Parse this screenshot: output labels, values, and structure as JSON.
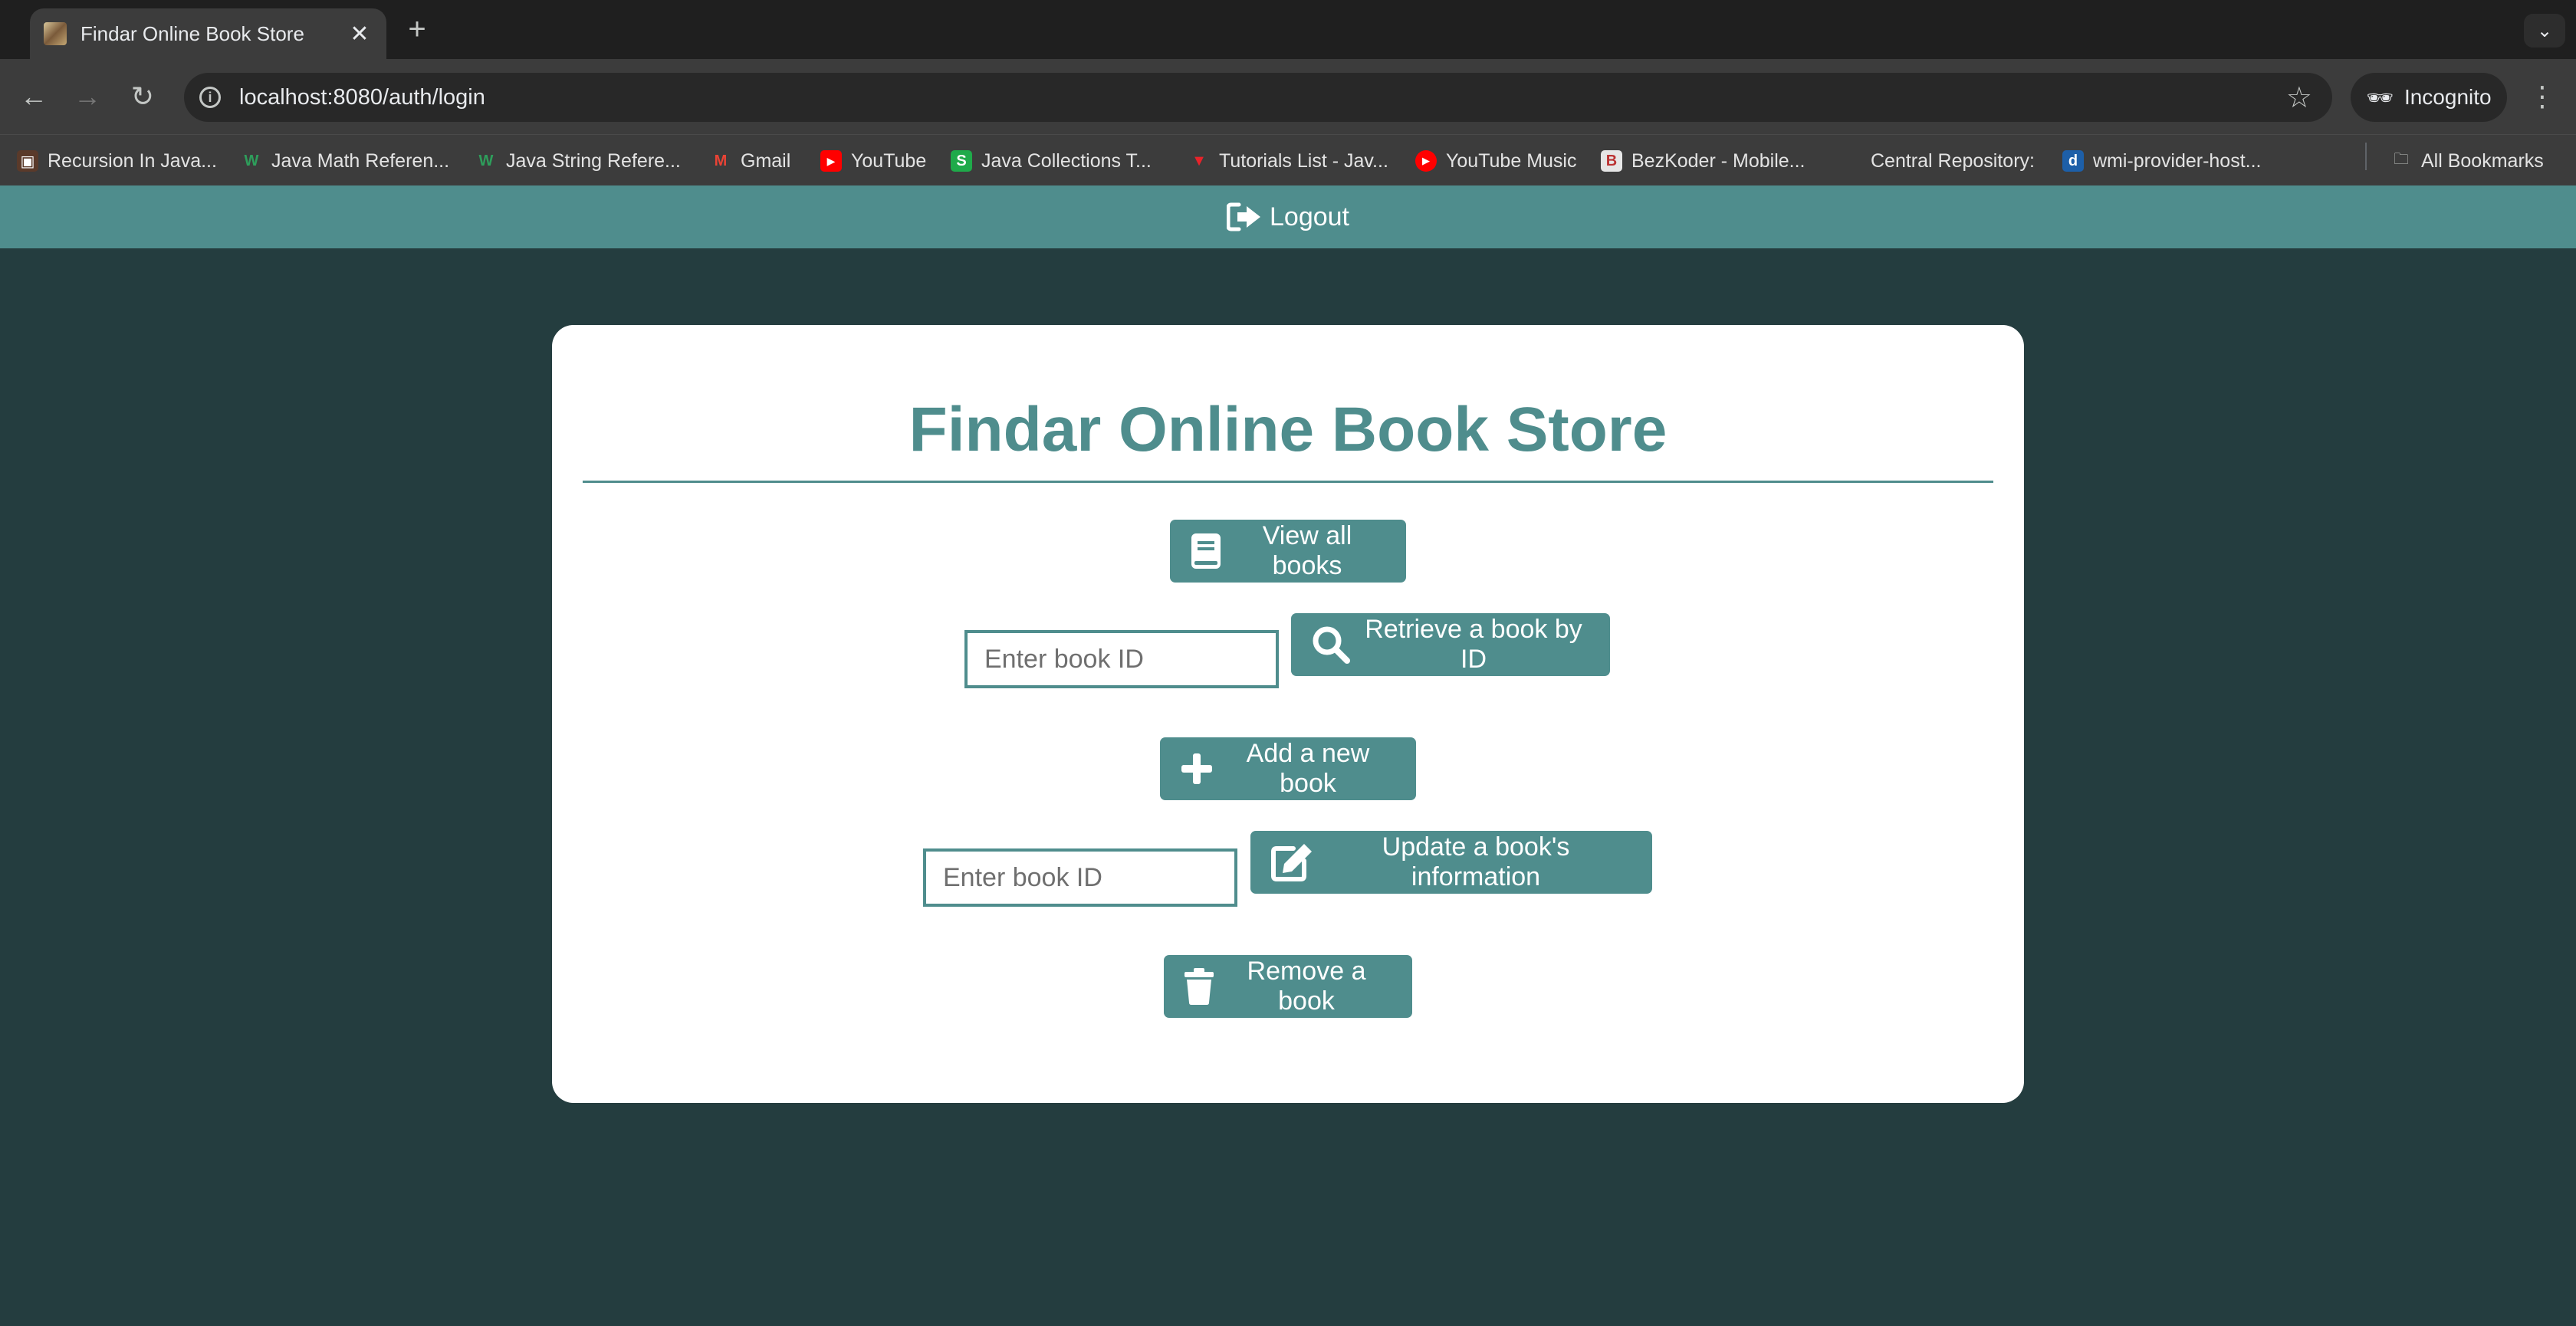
{
  "browser": {
    "tab_title": "Findar Online Book Store",
    "url": "localhost:8080/auth/login",
    "incognito_label": "Incognito",
    "bookmarks": [
      {
        "label": "Recursion In Java..."
      },
      {
        "label": "Java Math Referen..."
      },
      {
        "label": "Java String Refere..."
      },
      {
        "label": "Gmail"
      },
      {
        "label": "YouTube"
      },
      {
        "label": "Java Collections T..."
      },
      {
        "label": "Tutorials List - Jav..."
      },
      {
        "label": "YouTube Music"
      },
      {
        "label": "BezKoder - Mobile..."
      },
      {
        "label": "Central Repository:"
      },
      {
        "label": "wmi-provider-host..."
      }
    ],
    "all_bookmarks_label": "All Bookmarks"
  },
  "header": {
    "logout_label": "Logout"
  },
  "main": {
    "title": "Findar Online Book Store",
    "view_all_label": "View all books",
    "retrieve_input_placeholder": "Enter book ID",
    "retrieve_label": "Retrieve a book by ID",
    "add_label": "Add a new book",
    "update_input_placeholder": "Enter book ID",
    "update_label": "Update a book's information",
    "remove_label": "Remove a book"
  },
  "colors": {
    "background": "#243d3f",
    "accent": "#4f8d8d",
    "card": "#ffffff"
  },
  "icons": {
    "logout": "sign-out-icon",
    "view_all": "book-icon",
    "retrieve": "search-icon",
    "add": "plus-icon",
    "update": "edit-icon",
    "remove": "trash-icon"
  }
}
